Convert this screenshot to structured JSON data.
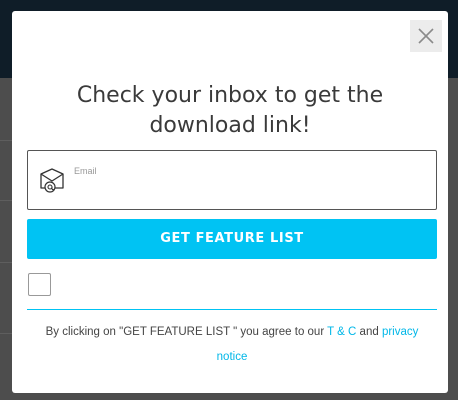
{
  "modal": {
    "title": "Check your inbox to get the download link!",
    "email": {
      "label": "Email",
      "value": "",
      "icon": "mail-at-icon"
    },
    "cta_label": "GET FEATURE LIST",
    "consent_checked": false,
    "terms": {
      "prefix": "By  clicking on \"GET FEATURE LIST \" you agree to our",
      "tc_link": "T & C",
      "and": "and",
      "privacy_link": "privacy notice"
    },
    "close_icon": "close-icon"
  },
  "colors": {
    "accent": "#00c3f3",
    "header_bg": "#0f1d28",
    "overlay_bg": "#4d4d4d",
    "title_text": "#3a3a3a"
  }
}
